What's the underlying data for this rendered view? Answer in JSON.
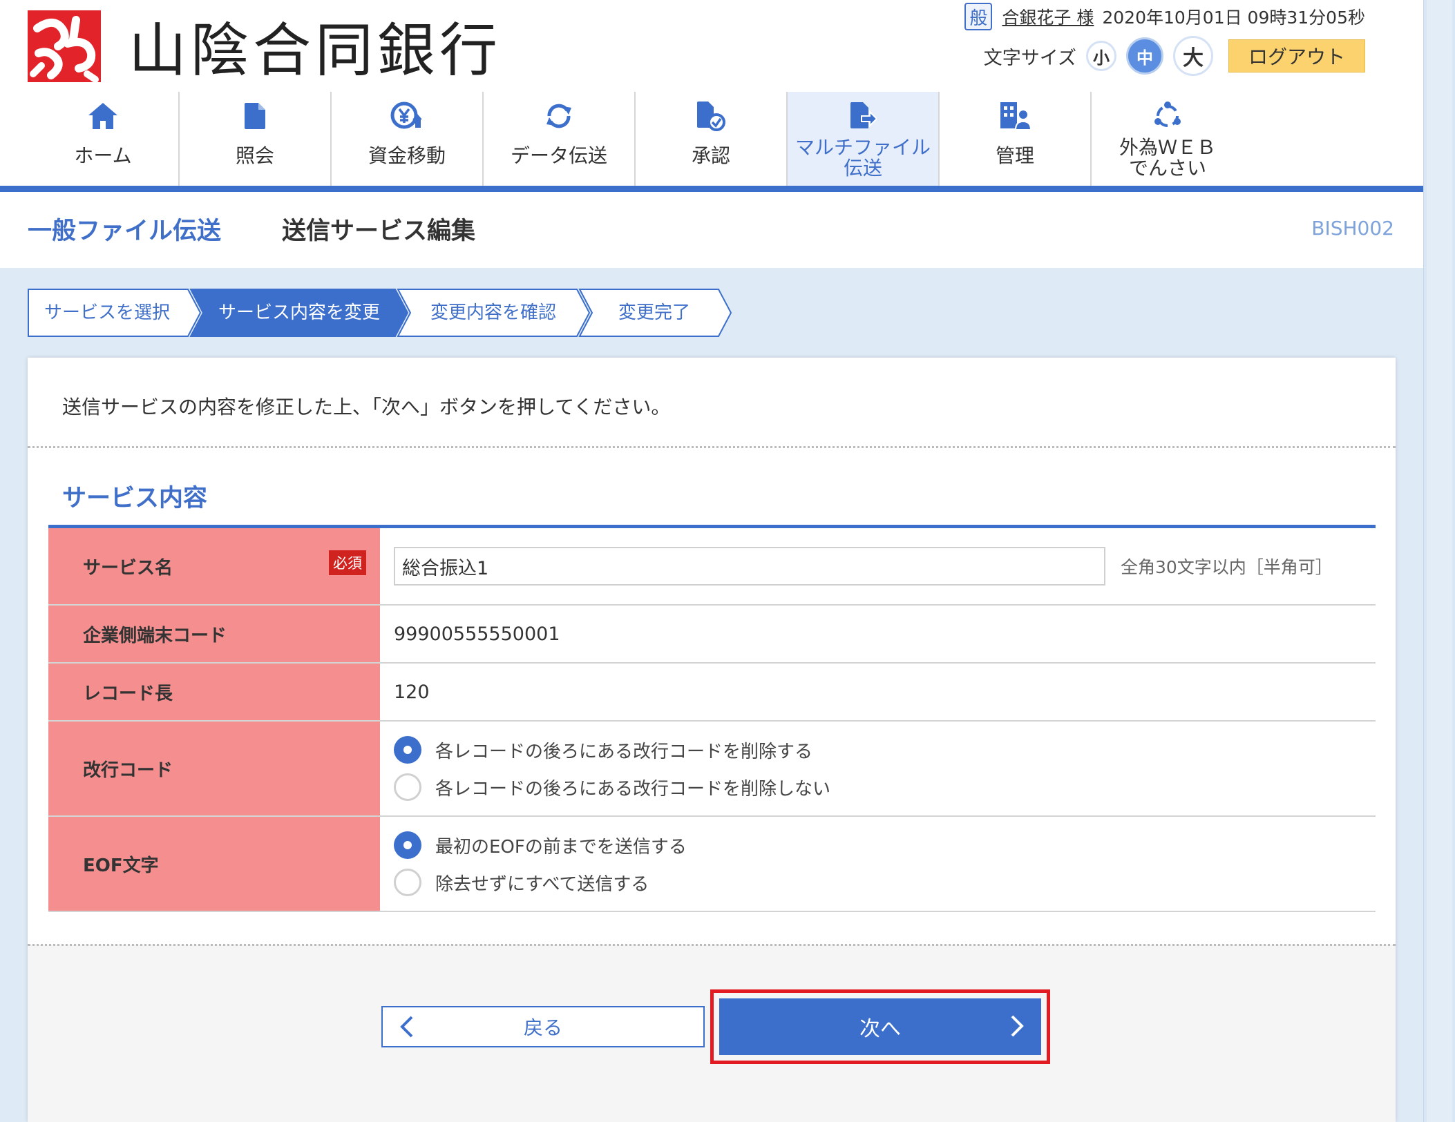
{
  "bank": {
    "name": "山陰合同銀行"
  },
  "user": {
    "badge": "般",
    "name": "合銀花子 様",
    "datetime": "2020年10月01日 09時31分05秒"
  },
  "font_size": {
    "label": "文字サイズ",
    "small": "小",
    "medium": "中",
    "large": "大",
    "selected": "中"
  },
  "logout_label": "ログアウト",
  "nav": [
    {
      "label": "ホーム",
      "icon": "home-icon"
    },
    {
      "label": "照会",
      "icon": "document-icon"
    },
    {
      "label": "資金移動",
      "icon": "yen-transfer-icon"
    },
    {
      "label": "データ伝送",
      "icon": "sync-icon"
    },
    {
      "label": "承認",
      "icon": "approve-icon"
    },
    {
      "label": "マルチファイル伝送",
      "line1": "マルチファイル",
      "line2": "伝送",
      "icon": "file-transfer-icon",
      "active": true
    },
    {
      "label": "管理",
      "icon": "admin-icon"
    },
    {
      "label": "外為ＷＥＢでんさい",
      "line1": "外為ＷＥＢ",
      "line2": "でんさい",
      "icon": "forex-icon"
    }
  ],
  "title": {
    "main": "一般ファイル伝送",
    "sub": "送信サービス編集",
    "screen_id": "BISH002"
  },
  "steps": [
    {
      "label": "サービスを選択"
    },
    {
      "label": "サービス内容を変更",
      "current": true
    },
    {
      "label": "変更内容を確認"
    },
    {
      "label": "変更完了"
    }
  ],
  "instruction": "送信サービスの内容を修正した上、「次へ」ボタンを押してください。",
  "section_title": "サービス内容",
  "form": {
    "service_name": {
      "label": "サービス名",
      "required_label": "必須",
      "value": "総合振込1",
      "hint": "全角30文字以内［半角可］"
    },
    "terminal_code": {
      "label": "企業側端末コード",
      "value": "99900555550001"
    },
    "record_length": {
      "label": "レコード長",
      "value": "120"
    },
    "newline_code": {
      "label": "改行コード",
      "options": [
        "各レコードの後ろにある改行コードを削除する",
        "各レコードの後ろにある改行コードを削除しない"
      ],
      "selected": 0
    },
    "eof_char": {
      "label": "EOF文字",
      "options": [
        "最初のEOFの前までを送信する",
        "除去せずにすべて送信する"
      ],
      "selected": 0
    }
  },
  "buttons": {
    "back": "戻る",
    "next": "次へ"
  },
  "colors": {
    "accent": "#3b6fcb",
    "label_bg": "#f58f8f",
    "required": "#d0231f",
    "logout": "#fbd26d",
    "highlight": "#e21b23"
  }
}
